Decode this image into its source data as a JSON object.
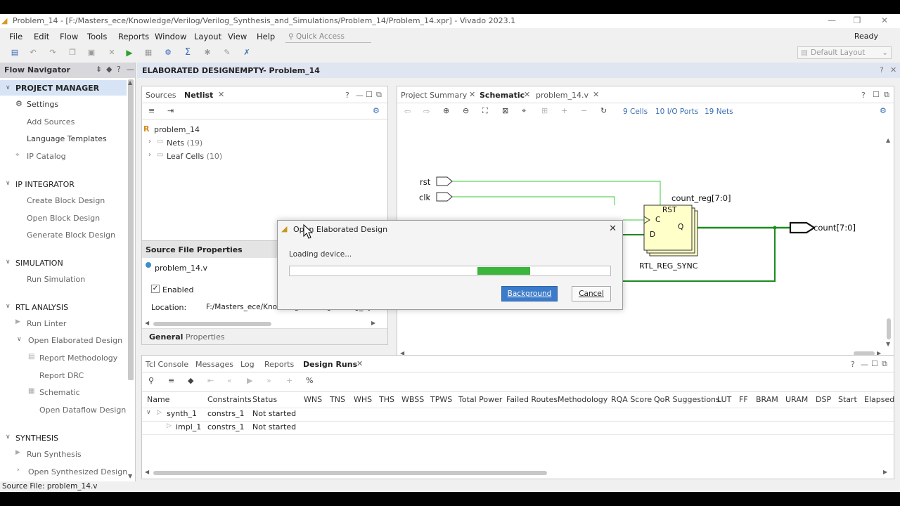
{
  "window": {
    "title": "Problem_14 - [F:/Masters_ece/Knowledge/Verilog/Verilog_Synthesis_and_Simulations/Problem_14/Problem_14.xpr] - Vivado 2023.1"
  },
  "menu": {
    "items": [
      "File",
      "Edit",
      "Flow",
      "Tools",
      "Reports",
      "Window",
      "Layout",
      "View",
      "Help"
    ],
    "quick_access_placeholder": "Quick Access",
    "status": "Ready"
  },
  "toolbar": {
    "layout_select": "Default Layout"
  },
  "flow_navigator": {
    "title": "Flow Navigator",
    "sections": {
      "project_manager": {
        "label": "PROJECT MANAGER",
        "items": [
          "Settings",
          "Add Sources",
          "Language Templates",
          "IP Catalog"
        ]
      },
      "ip_integrator": {
        "label": "IP INTEGRATOR",
        "items": [
          "Create Block Design",
          "Open Block Design",
          "Generate Block Design"
        ]
      },
      "simulation": {
        "label": "SIMULATION",
        "items": [
          "Run Simulation"
        ]
      },
      "rtl_analysis": {
        "label": "RTL ANALYSIS",
        "items": [
          "Run Linter",
          "Open Elaborated Design",
          "Report Methodology",
          "Report DRC",
          "Schematic",
          "Open Dataflow Design"
        ]
      },
      "synthesis": {
        "label": "SYNTHESIS",
        "items": [
          "Run Synthesis",
          "Open Synthesized Design"
        ]
      }
    }
  },
  "design_header": "ELABORATED DESIGNEMPTY- Problem_14",
  "netlist_panel": {
    "tabs": [
      "Sources",
      "Netlist"
    ],
    "root": "problem_14",
    "nodes": [
      {
        "label": "Nets",
        "count": "(19)"
      },
      {
        "label": "Leaf Cells",
        "count": "(10)"
      }
    ]
  },
  "source_props": {
    "title": "Source File Properties",
    "file": "problem_14.v",
    "enabled_label": "Enabled",
    "location_label": "Location:",
    "location_value": "F:/Masters_ece/Knowledge/Verilog/Verilog_Synthesis_a",
    "tabs": [
      "General",
      "Properties"
    ]
  },
  "schematic_panel": {
    "tabs": [
      "Project Summary",
      "Schematic",
      "problem_14.v"
    ],
    "stats": {
      "cells": "9 Cells",
      "ports": "10 I/O Ports",
      "nets": "19 Nets"
    },
    "ports": {
      "rst": "rst",
      "clk": "clk",
      "out": "count[7:0]"
    },
    "reg": {
      "name": "count_reg[7:0]",
      "type": "RTL_REG_SYNC",
      "pin_rst": "RST",
      "pin_c": "C",
      "pin_d": "D",
      "pin_q": "Q"
    }
  },
  "dialog": {
    "title": "Open Elaborated Design",
    "message": "Loading device...",
    "progress_start": 0.585,
    "progress_end": 0.75,
    "background_button": "Background",
    "cancel_button": "Cancel"
  },
  "bottom_panel": {
    "tabs": [
      "Tcl Console",
      "Messages",
      "Log",
      "Reports",
      "Design Runs"
    ],
    "columns": [
      "Name",
      "Constraints",
      "Status",
      "WNS",
      "TNS",
      "WHS",
      "THS",
      "WBSS",
      "TPWS",
      "Total Power",
      "Failed Routes",
      "Methodology",
      "RQA Score",
      "QoR Suggestions",
      "LUT",
      "FF",
      "BRAM",
      "URAM",
      "DSP",
      "Start",
      "Elapsed"
    ],
    "rows": [
      {
        "name": "synth_1",
        "constraints": "constrs_1",
        "status": "Not started"
      },
      {
        "name": "impl_1",
        "constraints": "constrs_1",
        "status": "Not started"
      }
    ]
  },
  "status_bar": "Source File: problem_14.v"
}
